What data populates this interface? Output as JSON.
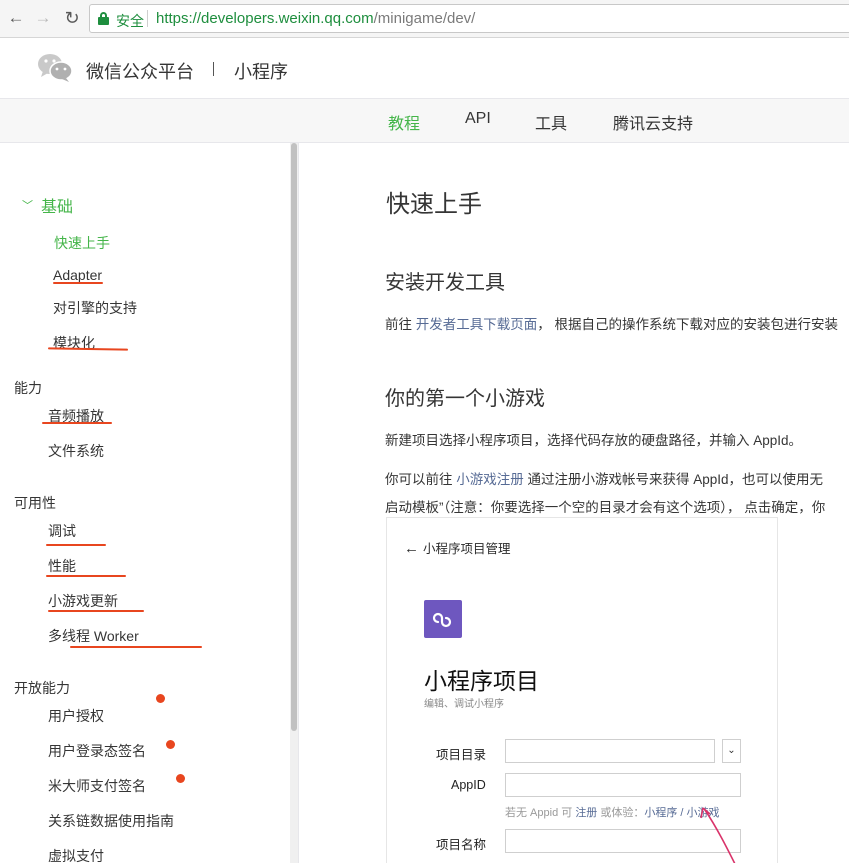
{
  "browser": {
    "secure_label": "安全",
    "url_host": "https://developers.weixin.qq.com",
    "url_path": "/minigame/dev/"
  },
  "header": {
    "brand": "微信公众平台",
    "product": "小程序"
  },
  "top_nav": [
    {
      "label": "教程",
      "active": true
    },
    {
      "label": "API",
      "active": false
    },
    {
      "label": "工具",
      "active": false
    },
    {
      "label": "腾讯云支持",
      "active": false
    }
  ],
  "sidebar": {
    "group_basic": "基础",
    "basic_items": [
      "快速上手",
      "Adapter",
      "对引擎的支持",
      "模块化"
    ],
    "group_ability": "能力",
    "ability_items": [
      "音频播放",
      "文件系统"
    ],
    "group_usability": "可用性",
    "usability_items": [
      "调试",
      "性能",
      "小游戏更新",
      "多线程 Worker"
    ],
    "group_open": "开放能力",
    "open_items": [
      "用户授权",
      "用户登录态签名",
      "米大师支付签名",
      "关系链数据使用指南",
      "虚拟支付"
    ]
  },
  "content": {
    "title": "快速上手",
    "section1_title": "安装开发工具",
    "section1_prefix": "前往 ",
    "section1_link": "开发者工具下载页面",
    "section1_suffix": "，  根据自己的操作系统下载对应的安装包进行安装",
    "section2_title": "你的第一个小游戏",
    "section2_para1": "新建项目选择小程序项目，选择代码存放的硬盘路径，并输入 AppId。",
    "section2_para2_prefix": "你可以前往 ",
    "section2_para2_link": "小游戏注册",
    "section2_para2_suffix": " 通过注册小游戏帐号来获得 AppId，也可以使用无",
    "section2_para3": "启动模板”（注意：你要选择一个空的目录才会有这个选项），  点击确定，你"
  },
  "ide": {
    "back_label": "小程序项目管理",
    "title": "小程序项目",
    "subtitle": "编辑、调试小程序",
    "label_dir": "项目目录",
    "label_appid": "AppID",
    "label_name": "项目名称",
    "hint_prefix": "若无 Appid 可 ",
    "hint_register": "注册",
    "hint_middle": " 或体验：",
    "hint_links": "小程序 / 小游戏"
  },
  "colors": {
    "accent_green": "#44b549",
    "link_blue": "#576b95",
    "annotation_red": "#e8461f",
    "miniprogram_purple": "#6e57bf"
  }
}
